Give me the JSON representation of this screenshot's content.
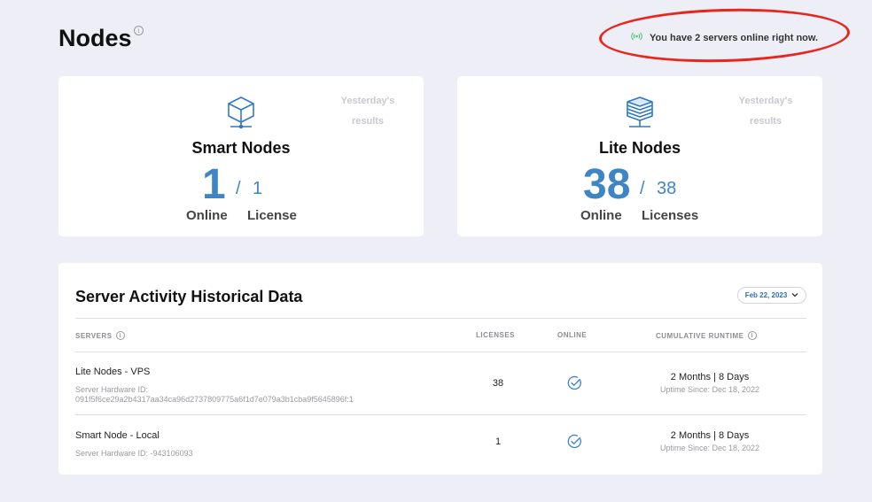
{
  "page": {
    "title": "Nodes"
  },
  "status": {
    "message": "You have 2 servers online right now."
  },
  "smart": {
    "title": "Smart Nodes",
    "online": "1",
    "licenses": "1",
    "online_label": "Online",
    "license_label": "License",
    "yesterday_line1": "Yesterday's",
    "yesterday_line2": "results"
  },
  "lite": {
    "title": "Lite Nodes",
    "online": "38",
    "licenses": "38",
    "online_label": "Online",
    "license_label": "Licenses",
    "yesterday_line1": "Yesterday's",
    "yesterday_line2": "results"
  },
  "history": {
    "title": "Server Activity Historical Data",
    "date": "Feb 22, 2023",
    "columns": {
      "servers": "SERVERS",
      "licenses": "LICENSES",
      "online": "ONLINE",
      "runtime": "CUMULATIVE RUNTIME"
    },
    "rows": [
      {
        "name": "Lite Nodes - VPS",
        "hw_label": "Server Hardware ID:",
        "hw_id": "091f5f6ce29a2b4317aa34ca96d2737809775a6f1d7e079a3b1cba9f5645896f:1",
        "licenses": "38",
        "runtime": "2 Months | 8 Days",
        "uptime": "Uptime Since: Dec 18, 2022"
      },
      {
        "name": "Smart Node - Local",
        "hw_label": "Server Hardware ID:",
        "hw_id": "-943106093",
        "licenses": "1",
        "runtime": "2 Months | 8 Days",
        "uptime": "Uptime Since: Dec 18, 2022"
      }
    ]
  },
  "colors": {
    "accent": "#3d85c6",
    "annotation": "#e8261d",
    "online_signal": "#3cc46a",
    "background": "#eeeef7"
  },
  "icons": [
    "info-icon",
    "signal-icon",
    "cube-network-icon",
    "server-stack-icon",
    "chevron-down-icon",
    "check-circle-icon"
  ]
}
